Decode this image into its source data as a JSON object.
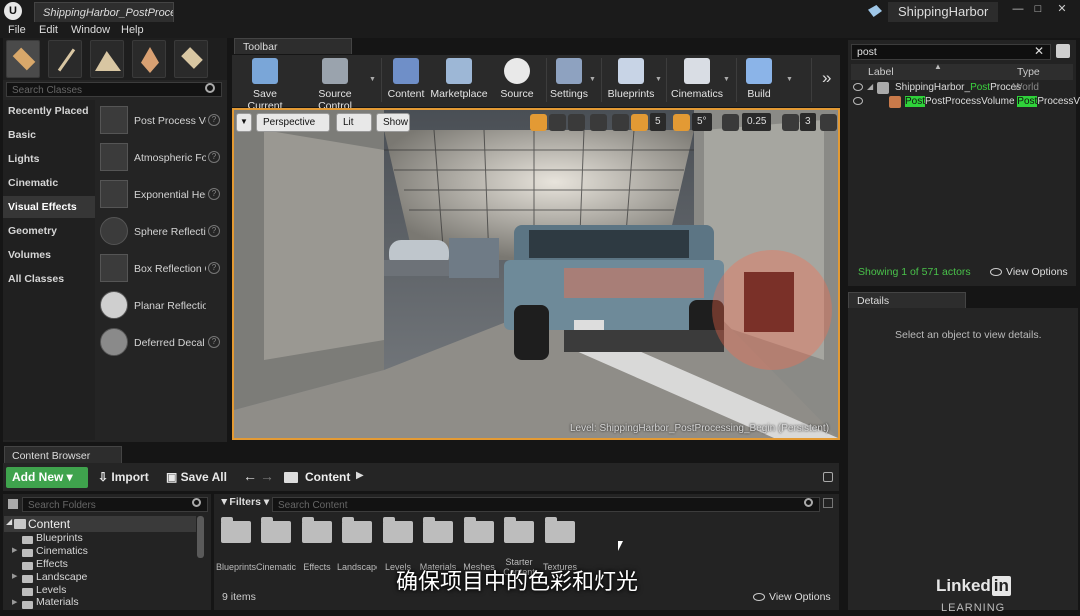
{
  "window": {
    "doc_tab": "ShippingHarbor_PostProcess",
    "project_name": "ShippingHarbor",
    "min": "—",
    "max": "□",
    "close": "✕"
  },
  "menu": [
    "File",
    "Edit",
    "Window",
    "Help"
  ],
  "modes": {
    "search_placeholder": "Search Classes",
    "categories": [
      "Recently Placed",
      "Basic",
      "Lights",
      "Cinematic",
      "Visual Effects",
      "Geometry",
      "Volumes",
      "All Classes"
    ],
    "active_category": "Visual Effects",
    "items": [
      "Post Process Volume",
      "Atmospheric Fog",
      "Exponential Height Fog",
      "Sphere Reflection Capture",
      "Box Reflection Capture",
      "Planar Reflection",
      "Deferred Decal"
    ],
    "help_glyph": "?"
  },
  "toolbar": {
    "tab_label": "Toolbar",
    "buttons": [
      "Save Current",
      "Source Control",
      "Content",
      "Marketplace",
      "Source",
      "Settings",
      "Blueprints",
      "Cinematics",
      "Build"
    ],
    "overflow": "»"
  },
  "viewport": {
    "perspective": "Perspective",
    "lit": "Lit",
    "show": "Show",
    "grid_snap": "5",
    "rotation_snap": "5°",
    "scale_snap": "0.25",
    "camera_speed": "3",
    "level_text": "Level:  ShippingHarbor_PostProcessing_Begin (Persistent)"
  },
  "outliner": {
    "search_value": "post",
    "col_label": "Label",
    "col_type": "Type",
    "row1_pre": "ShippingHarbor_",
    "row1_hl": "Post",
    "row1_post": "Proces",
    "row1_type": "World",
    "row2_hl": "Post",
    "row2_mid": "PostProcessVolume",
    "row2_type_hl": "Post",
    "row2_type": "ProcessV",
    "status": "Showing 1 of 571 actors",
    "view_options": "View Options"
  },
  "details": {
    "tab_label": "Details",
    "empty_text": "Select an object to view details."
  },
  "content_browser": {
    "tab_label": "Content Browser",
    "add_new": "Add New",
    "import": "Import",
    "save_all": "Save All",
    "path": "Content",
    "search_folders": "Search Folders",
    "filters": "Filters",
    "search_content": "Search Content",
    "tree_root": "Content",
    "tree": [
      "Blueprints",
      "Cinematics",
      "Effects",
      "Landscape",
      "Levels",
      "Materials"
    ],
    "folders": [
      "Blueprints",
      "Cinematics",
      "Effects",
      "Landscape",
      "Levels",
      "Materials",
      "Meshes",
      "Starter Content",
      "Textures"
    ],
    "item_count": "9 items",
    "view_options": "View Options"
  },
  "overlay": {
    "subtitle": "确保项目中的色彩和灯光",
    "watermark_a": "Linked",
    "watermark_b": "in",
    "watermark_c": "LEARNING"
  },
  "colors": {
    "accent": "#e39a34",
    "add_new": "#3fa34d",
    "highlight": "#2fd23a",
    "selected": "#3a3a3a"
  }
}
